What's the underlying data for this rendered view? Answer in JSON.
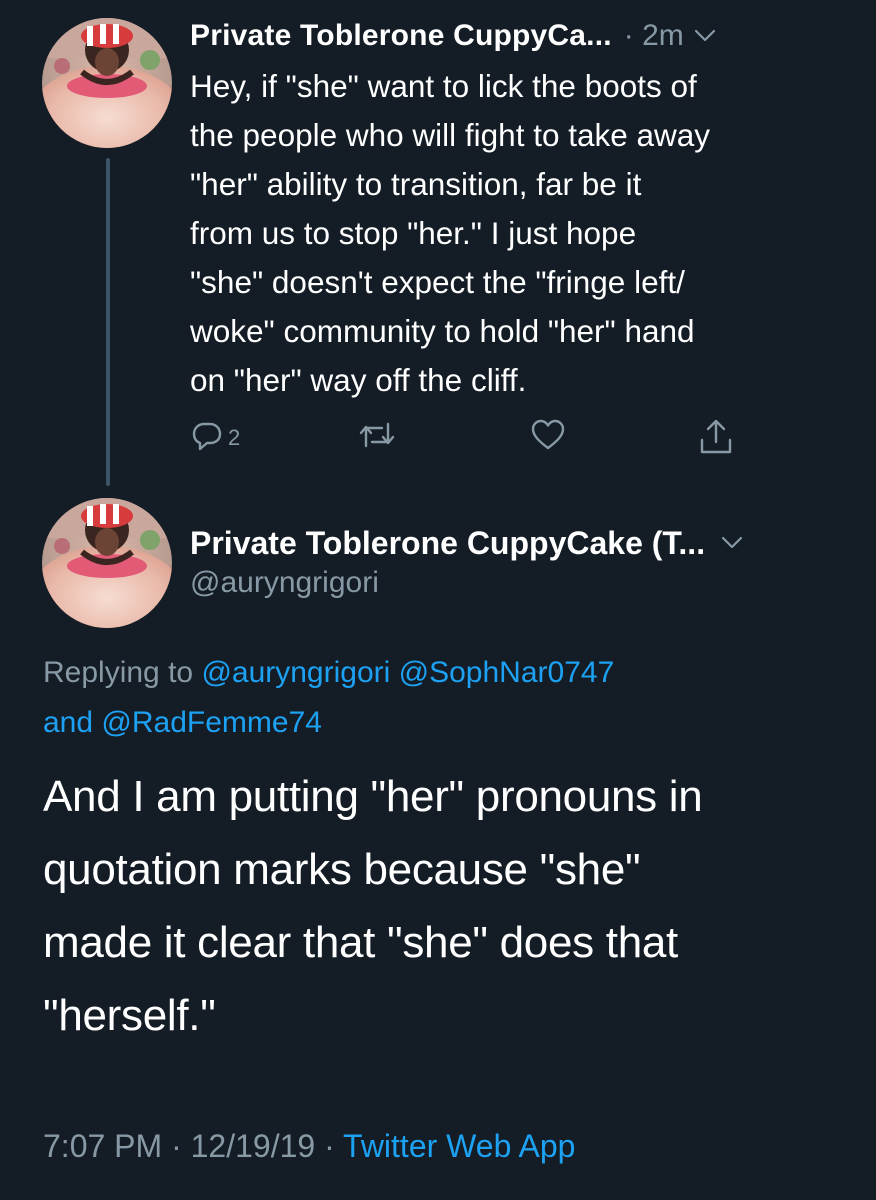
{
  "tweet1": {
    "display_name": "Private Toblerone CuppyCa...",
    "time": "· 2m",
    "text": "Hey, if \"she\" want to lick the boots of\nthe people who will fight to take away\n\"her\" ability to transition, far be it\nfrom us to stop \"her.\" I just hope\n\"she\" doesn't expect the \"fringe left/\nwoke\" community to hold \"her\" hand\non \"her\" way off the cliff.",
    "reply_count": "2",
    "icons": [
      "reply-icon",
      "retweet-icon",
      "like-icon",
      "share-icon",
      "chevron-down-icon"
    ]
  },
  "tweet2": {
    "display_name": "Private Toblerone CuppyCake (T...",
    "handle": "@auryngrigori",
    "replying_prefix": "Replying to",
    "replying_mention_1": "@auryngrigori",
    "replying_mention_2": "@SophNar0747",
    "replying_and": "and",
    "replying_mention_3": "@RadFemme74",
    "text": "And I am putting \"her\" pronouns in\nquotation marks because \"she\"\nmade it clear that \"she\" does that\n\"herself.\"",
    "timestamp": "7:07 PM · 12/19/19 ·",
    "source": "Twitter Web App"
  },
  "colors": {
    "background": "#141d26",
    "text_primary": "#ffffff",
    "text_secondary": "#8899a6",
    "link": "#1da1f2",
    "thread_line": "#3d5466"
  }
}
